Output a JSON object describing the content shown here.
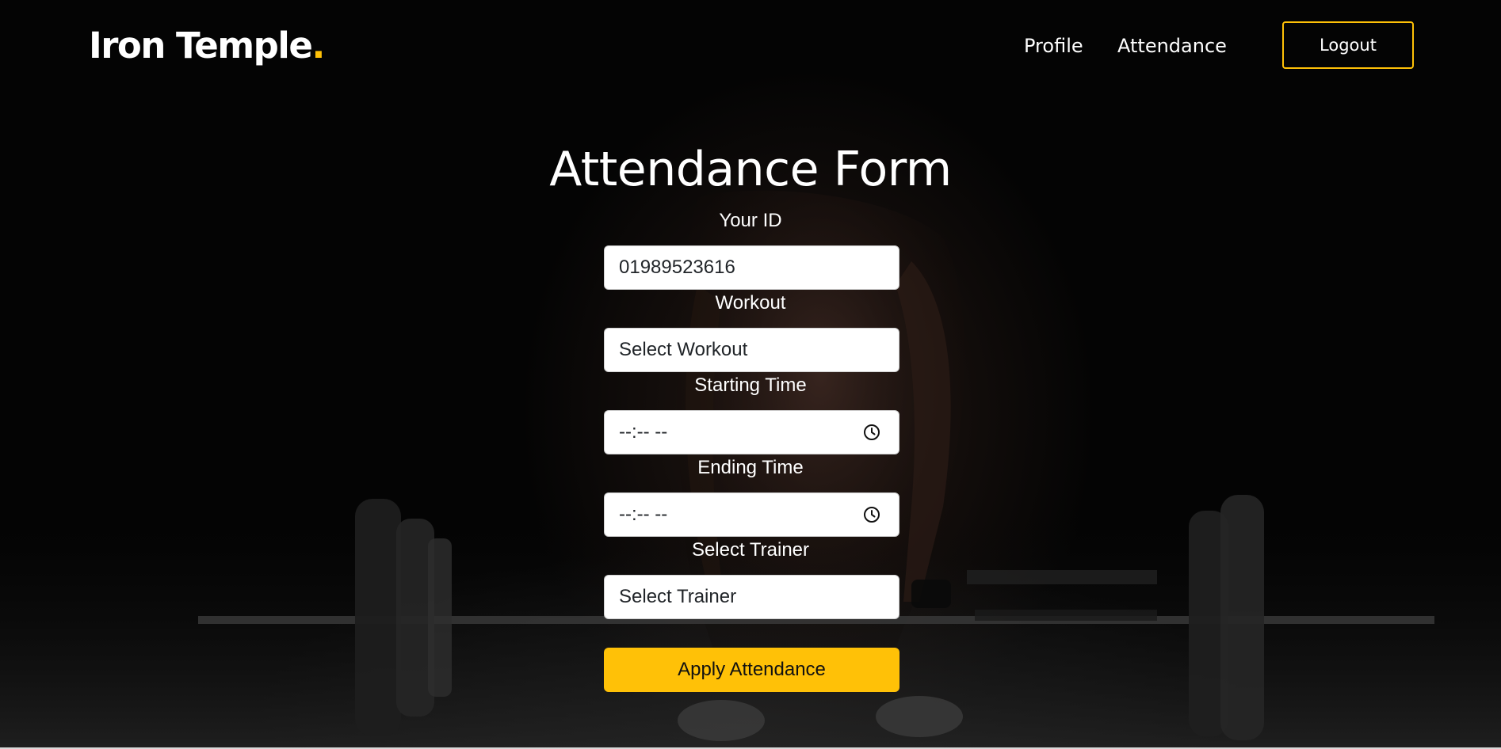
{
  "brand": {
    "name": "Iron Temple",
    "dot": "."
  },
  "nav": {
    "profile_label": "Profile",
    "attendance_label": "Attendance",
    "logout_label": "Logout"
  },
  "form": {
    "title": "Attendance Form",
    "id_label": "Your ID",
    "id_value": "01989523616",
    "workout_label": "Workout",
    "workout_value": "Select Workout",
    "start_label": "Starting Time",
    "start_value": "--:-- --",
    "end_label": "Ending Time",
    "end_value": "--:-- --",
    "trainer_label": "Select Trainer",
    "trainer_value": "Select Trainer",
    "submit_label": "Apply Attendance"
  },
  "colors": {
    "accent": "#ffc107",
    "background": "#050505",
    "text": "#ffffff",
    "field_text": "#212529"
  },
  "icons": {
    "start_time": "clock-icon",
    "end_time": "clock-icon"
  }
}
